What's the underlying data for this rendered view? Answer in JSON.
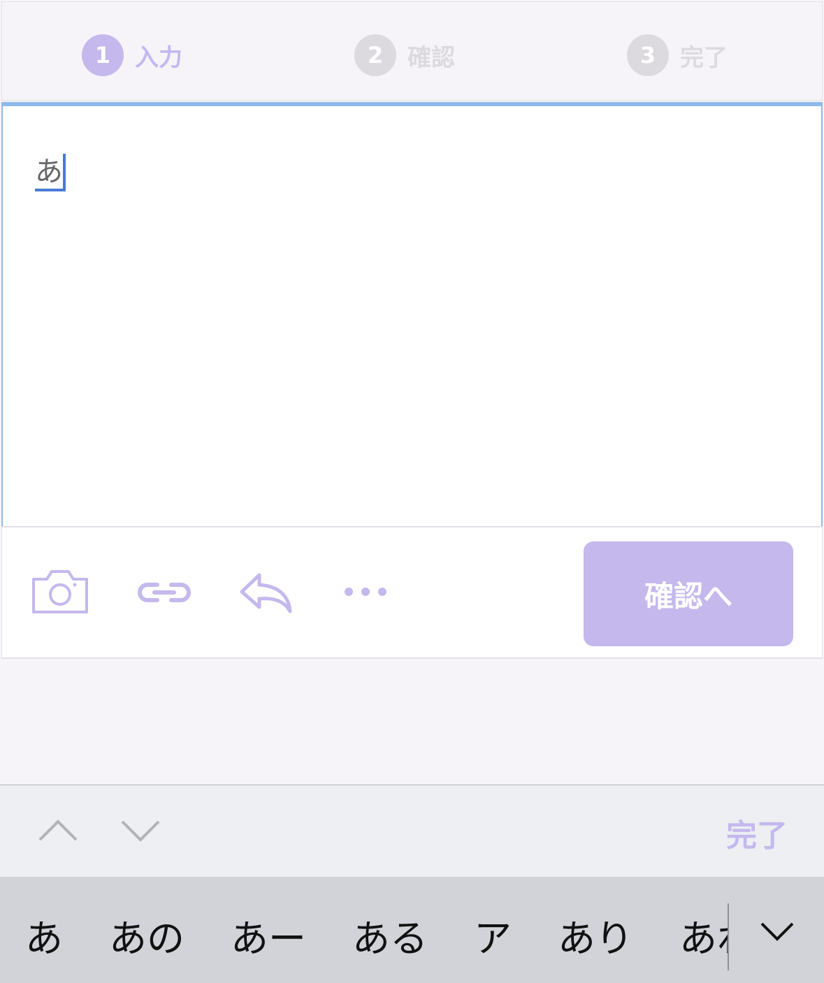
{
  "steps": [
    {
      "num": "1",
      "label": "入力",
      "state": "active"
    },
    {
      "num": "2",
      "label": "確認",
      "state": "inactive"
    },
    {
      "num": "3",
      "label": "完了",
      "state": "inactive"
    }
  ],
  "editor": {
    "text": "あ"
  },
  "toolbar": {
    "icons": [
      "camera-icon",
      "link-icon",
      "reply-icon",
      "more-icon"
    ],
    "confirm_label": "確認へ"
  },
  "accessory": {
    "done_label": "完了"
  },
  "suggestions": [
    "あ",
    "あの",
    "あー",
    "ある",
    "ア",
    "あり",
    "あれ"
  ],
  "colors": {
    "accent": "#c4b8ed",
    "inactive": "#dcdadf",
    "focus_border": "#8fb9ea",
    "caret": "#4a7bd6"
  }
}
